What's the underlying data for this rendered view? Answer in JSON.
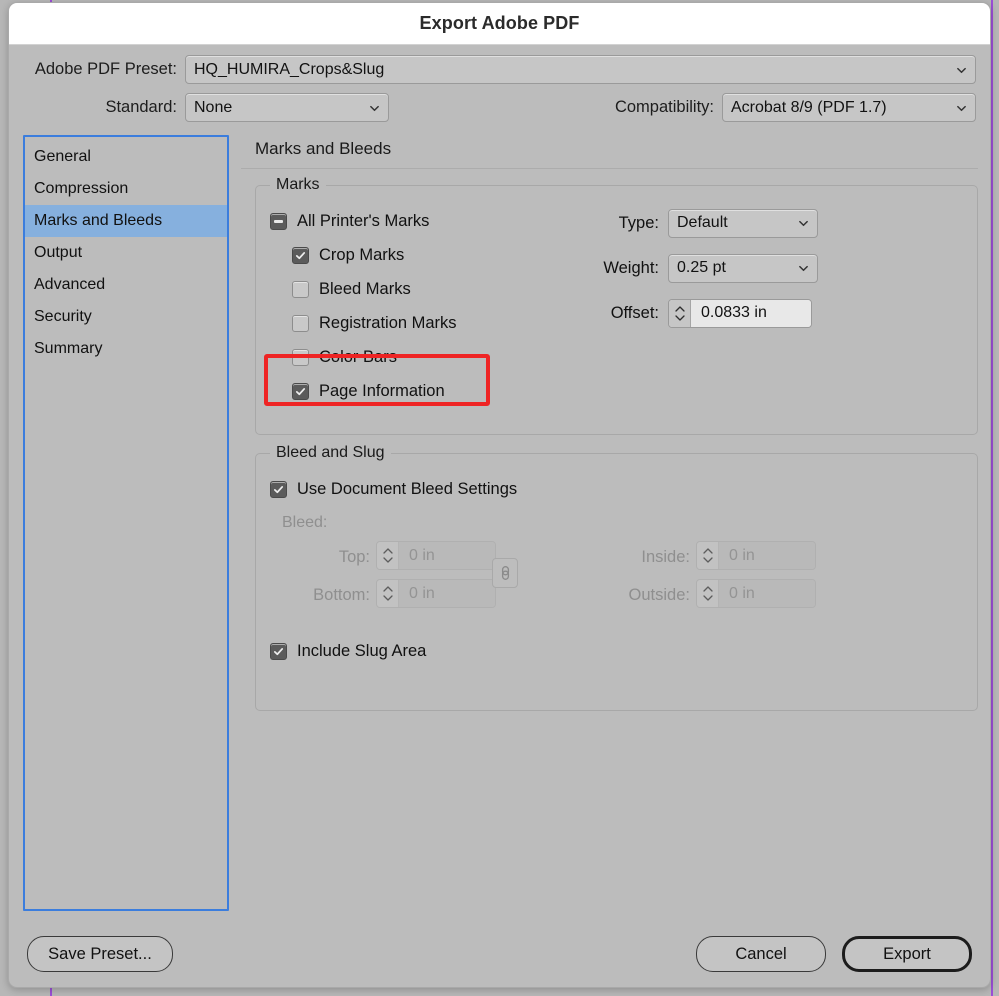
{
  "window": {
    "title": "Export Adobe PDF"
  },
  "top": {
    "preset_label": "Adobe PDF Preset:",
    "preset_value": "HQ_HUMIRA_Crops&Slug",
    "standard_label": "Standard:",
    "standard_value": "None",
    "compatibility_label": "Compatibility:",
    "compatibility_value": "Acrobat 8/9 (PDF 1.7)"
  },
  "sidebar": {
    "items": [
      {
        "label": "General",
        "selected": false
      },
      {
        "label": "Compression",
        "selected": false
      },
      {
        "label": "Marks and Bleeds",
        "selected": true
      },
      {
        "label": "Output",
        "selected": false
      },
      {
        "label": "Advanced",
        "selected": false
      },
      {
        "label": "Security",
        "selected": false
      },
      {
        "label": "Summary",
        "selected": false
      }
    ]
  },
  "panel": {
    "title": "Marks and Bleeds",
    "marks": {
      "legend": "Marks",
      "all_printers_marks": {
        "label": "All Printer's Marks",
        "state": "mixed"
      },
      "items": [
        {
          "label": "Crop Marks",
          "state": "checked"
        },
        {
          "label": "Bleed Marks",
          "state": "unchecked"
        },
        {
          "label": "Registration Marks",
          "state": "unchecked"
        },
        {
          "label": "Color Bars",
          "state": "unchecked"
        },
        {
          "label": "Page Information",
          "state": "checked"
        }
      ],
      "type_label": "Type:",
      "type_value": "Default",
      "weight_label": "Weight:",
      "weight_value": "0.25 pt",
      "offset_label": "Offset:",
      "offset_value": "0.0833 in"
    },
    "bleed": {
      "legend": "Bleed and Slug",
      "use_document_bleed": {
        "label": "Use Document Bleed Settings",
        "state": "checked"
      },
      "bleed_heading": "Bleed:",
      "top_label": "Top:",
      "top_value": "0 in",
      "bottom_label": "Bottom:",
      "bottom_value": "0 in",
      "inside_label": "Inside:",
      "inside_value": "0 in",
      "outside_label": "Outside:",
      "outside_value": "0 in",
      "link_icon": "chain-link-icon",
      "include_slug": {
        "label": "Include Slug Area",
        "state": "checked"
      }
    }
  },
  "footer": {
    "save_preset": "Save Preset...",
    "cancel": "Cancel",
    "export": "Export"
  },
  "annotation": {
    "highlight_color": "#ee2424",
    "highlight_target": "Page Information"
  }
}
